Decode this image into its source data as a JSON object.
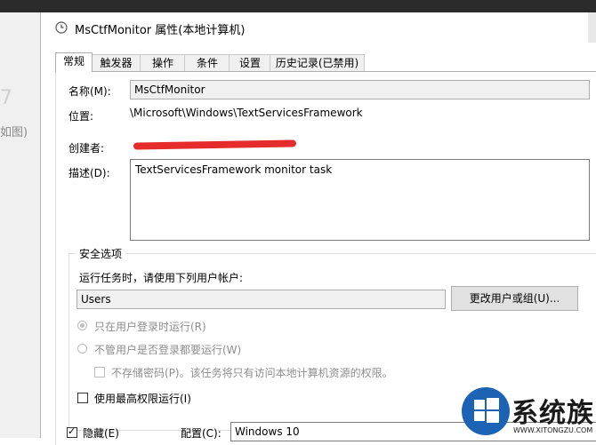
{
  "background": {
    "side_text": "如图)",
    "side_digit": "7"
  },
  "window": {
    "title": "MsCtfMonitor 属性(本地计算机)",
    "icon": "clock-icon"
  },
  "tabs": [
    {
      "label": "常规",
      "active": true
    },
    {
      "label": "触发器",
      "active": false
    },
    {
      "label": "操作",
      "active": false
    },
    {
      "label": "条件",
      "active": false
    },
    {
      "label": "设置",
      "active": false
    },
    {
      "label": "历史记录(已禁用)",
      "active": false
    }
  ],
  "general": {
    "name_label": "名称(M):",
    "name_value": "MsCtfMonitor",
    "location_label": "位置:",
    "location_value": "\\Microsoft\\Windows\\TextServicesFramework",
    "author_label": "创建者:",
    "description_label": "描述(D):",
    "description_value": "TextServicesFramework monitor task"
  },
  "security": {
    "group_title": "安全选项",
    "run_as_label": "运行任务时，请使用下列用户帐户:",
    "user_value": "Users",
    "change_user_button": "更改用户或组(U)...",
    "radio_logged_on": "只在用户登录时运行(R)",
    "radio_whether": "不管用户是否登录都要运行(W)",
    "no_store_password": "不存储密码(P)。该任务将只有访问本地计算机资源的权限。",
    "highest_privileges": "使用最高权限运行(I)"
  },
  "bottom": {
    "hidden_label": "隐藏(E)",
    "hidden_checked": true,
    "configure_label": "配置(C):",
    "configure_value": "Windows 10"
  },
  "watermark": {
    "name": "系统族",
    "url": "WWW.XITONGZU.COM",
    "logo": "windows-logo-icon"
  },
  "colors": {
    "watermark_blue": "#1c63b6",
    "redaction": "#e52b2b"
  }
}
